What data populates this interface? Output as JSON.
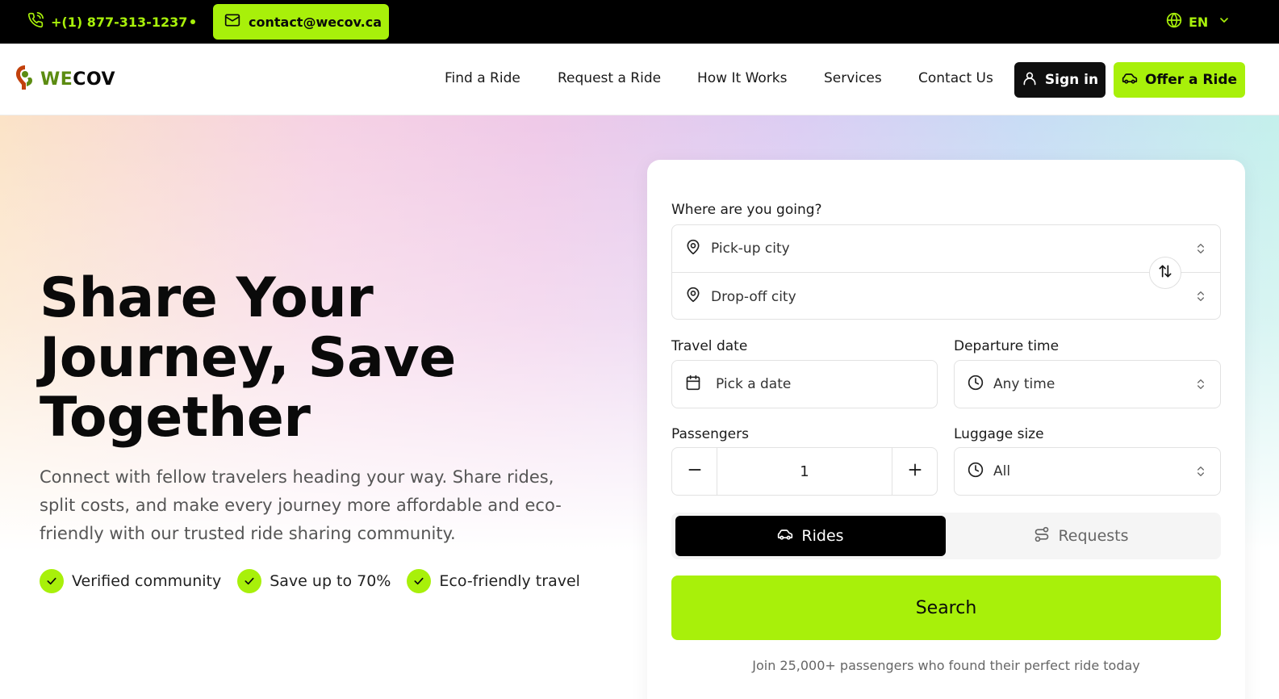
{
  "topbar": {
    "phone": "+(1) 877-313-1237",
    "email": "contact@wecov.ca",
    "language": "EN"
  },
  "nav": {
    "logo_we": "WE",
    "logo_cov": "COV",
    "links": [
      "Find a Ride",
      "Request a Ride",
      "How It Works",
      "Services",
      "Contact Us"
    ],
    "signin_label": "Sign in",
    "offer_label": "Offer a Ride"
  },
  "hero": {
    "headline": "Share Your Journey, Save Together",
    "subtext": "Connect with fellow travelers heading your way. Share rides, split costs, and make every journey more affordable and eco-friendly with our trusted ride sharing community.",
    "features": [
      "Verified community",
      "Save up to 70%",
      "Eco-friendly travel"
    ]
  },
  "search_card": {
    "where_label": "Where are you going?",
    "pickup_placeholder": "Pick-up city",
    "dropoff_placeholder": "Drop-off city",
    "travel_date_label": "Travel date",
    "travel_date_placeholder": "Pick a date",
    "departure_label": "Departure time",
    "departure_value": "Any time",
    "passengers_label": "Passengers",
    "passengers_value": "1",
    "luggage_label": "Luggage size",
    "luggage_value": "All",
    "mode_rides": "Rides",
    "mode_requests": "Requests",
    "search_label": "Search",
    "join_text": "Join 25,000+ passengers who found their perfect ride today"
  },
  "colors": {
    "accent": "#a8f00a",
    "dark": "#000000",
    "logo_green": "#5c8c12"
  }
}
